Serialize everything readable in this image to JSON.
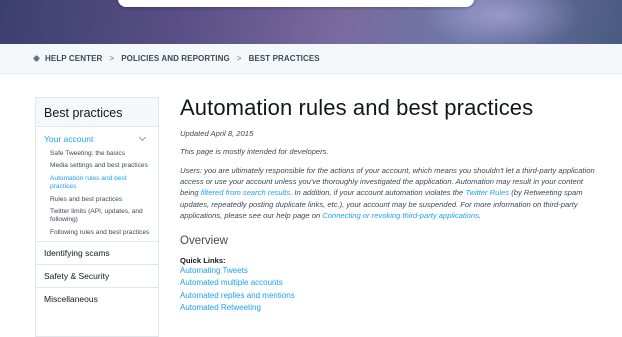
{
  "breadcrumb": {
    "items": [
      "HELP CENTER",
      "POLICIES AND REPORTING",
      "BEST PRACTICES"
    ],
    "separator": ">"
  },
  "sidebar": {
    "title": "Best practices",
    "section": "Your account",
    "sub_items": [
      "Safe Tweeting: the basics",
      "Media settings and best practices",
      "Automation rules and best practices",
      "Rules and best practices",
      "Twitter limits (API, updates, and following)",
      "Following rules and best practices"
    ],
    "active_index": 2,
    "categories": [
      "Identifying scams",
      "Safety & Security",
      "Miscellaneous"
    ]
  },
  "article": {
    "title": "Automation rules and best practices",
    "updated": "Updated April 8, 2015",
    "intro": "This page is mostly intended for developers.",
    "p_a": "Users: you are ultimately responsible for the actions of your account, which means you shouldn't let a third-party application access or use your account unless you've thoroughly investigated the application. Automation may result in your content being ",
    "link_filtered": "filtered from search results",
    "p_b": ". In addition, if your account automation violates the ",
    "link_rules": "Twitter Rules",
    "p_c": " (by Retweeting spam updates, repeatedly posting duplicate links, etc.), your account may be suspended. For more information on third-party applications, please see our help page on ",
    "link_connecting": "Connecting or revoking third-party applications",
    "p_d": ".",
    "overview": "Overview",
    "quick_links_label": "Quick Links:",
    "quick_links": [
      "Automating Tweets",
      "Automated multiple accounts",
      "Automated replies and mentions",
      "Automated Retweeting"
    ]
  },
  "colors": {
    "link": "#1da1f2",
    "hero": "#5a4f86"
  }
}
